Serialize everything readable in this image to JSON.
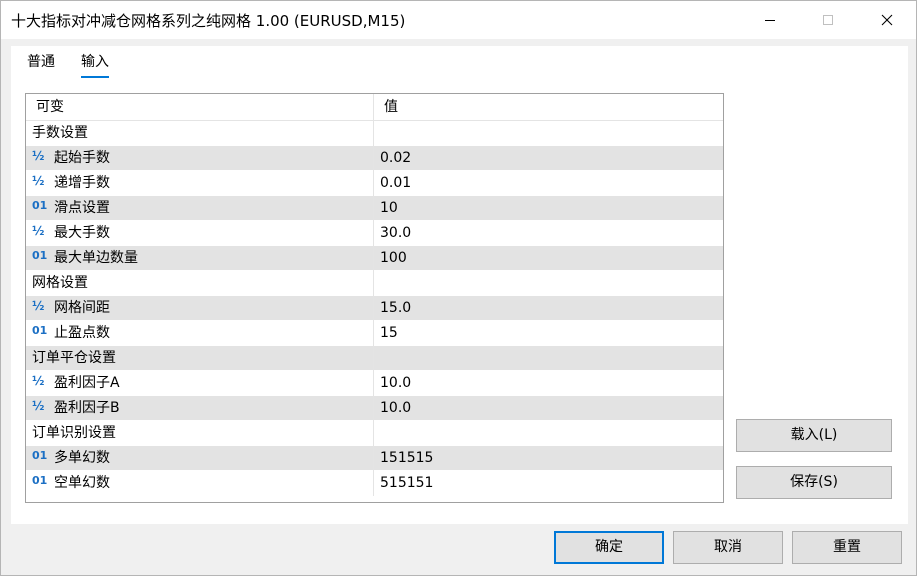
{
  "window": {
    "title": "十大指标对冲减仓网格系列之纯网格 1.00 (EURUSD,M15)"
  },
  "tabs": [
    {
      "label": "普通",
      "active": false
    },
    {
      "label": "输入",
      "active": true
    }
  ],
  "grid": {
    "col_variable": "可变",
    "col_value": "值",
    "rows": [
      {
        "type": "section",
        "label": "手数设置",
        "value": ""
      },
      {
        "type": "param",
        "icon": "fraction-icon",
        "icon_text": "½",
        "label": "起始手数",
        "value": "0.02"
      },
      {
        "type": "param",
        "icon": "fraction-icon",
        "icon_text": "½",
        "label": "递增手数",
        "value": "0.01"
      },
      {
        "type": "param",
        "icon": "integer-icon",
        "icon_text": "01",
        "label": "滑点设置",
        "value": "10"
      },
      {
        "type": "param",
        "icon": "fraction-icon",
        "icon_text": "½",
        "label": "最大手数",
        "value": "30.0"
      },
      {
        "type": "param",
        "icon": "integer-icon",
        "icon_text": "01",
        "label": "最大单边数量",
        "value": "100"
      },
      {
        "type": "section",
        "label": "网格设置",
        "value": ""
      },
      {
        "type": "param",
        "icon": "fraction-icon",
        "icon_text": "½",
        "label": "网格间距",
        "value": "15.0"
      },
      {
        "type": "param",
        "icon": "integer-icon",
        "icon_text": "01",
        "label": "止盈点数",
        "value": "15"
      },
      {
        "type": "section",
        "label": "订单平仓设置",
        "value": ""
      },
      {
        "type": "param",
        "icon": "fraction-icon",
        "icon_text": "½",
        "label": "盈利因子A",
        "value": "10.0"
      },
      {
        "type": "param",
        "icon": "fraction-icon",
        "icon_text": "½",
        "label": "盈利因子B",
        "value": "10.0"
      },
      {
        "type": "section",
        "label": "订单识别设置",
        "value": ""
      },
      {
        "type": "param",
        "icon": "integer-icon",
        "icon_text": "01",
        "label": "多单幻数",
        "value": "151515"
      },
      {
        "type": "param",
        "icon": "integer-icon",
        "icon_text": "01",
        "label": "空单幻数",
        "value": "515151"
      }
    ]
  },
  "side_buttons": {
    "load_label": "载入(L)",
    "save_label": "保存(S)"
  },
  "bottom_buttons": {
    "ok_label": "确定",
    "cancel_label": "取消",
    "reset_label": "重置"
  },
  "colors": {
    "accent": "#0078d7",
    "icon": "#1b6fc4",
    "row_shade": "#e3e3e3"
  }
}
